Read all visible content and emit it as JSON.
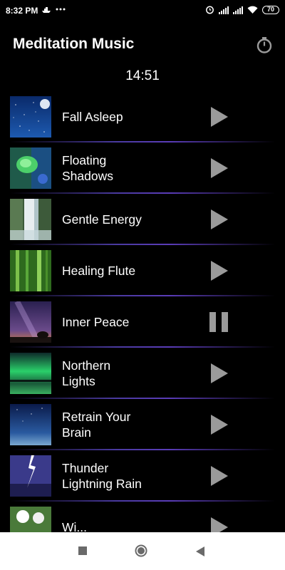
{
  "status_bar": {
    "time": "8:32 PM",
    "battery": "70",
    "icons": [
      "boat-icon",
      "more-dots-icon",
      "alarm-icon",
      "signal-icon",
      "signal-icon",
      "wifi-icon",
      "battery-icon"
    ]
  },
  "header": {
    "title": "Meditation Music",
    "timer_icon": "stopwatch-icon"
  },
  "timer": {
    "value": "14:51"
  },
  "tracks": [
    {
      "title": "Fall Asleep",
      "state": "play",
      "thumb": "starry-sky-moon"
    },
    {
      "title": "Floating\nShadows",
      "state": "play",
      "thumb": "green-leaf"
    },
    {
      "title": "Gentle Energy",
      "state": "play",
      "thumb": "waterfall"
    },
    {
      "title": "Healing Flute",
      "state": "play",
      "thumb": "bamboo-forest"
    },
    {
      "title": "Inner Peace",
      "state": "pause",
      "thumb": "milky-way-tree"
    },
    {
      "title": "Northern\nLights",
      "state": "play",
      "thumb": "aurora"
    },
    {
      "title": "Retrain Your\nBrain",
      "state": "play",
      "thumb": "night-sky-horizon"
    },
    {
      "title": "Thunder\nLightning Rain",
      "state": "play",
      "thumb": "lightning-storm"
    },
    {
      "title": "Wi...",
      "state": "play",
      "thumb": "white-flowers"
    }
  ],
  "colors": {
    "background": "#000000",
    "play_icon": "#9a9a9a",
    "divider": "#5a3cb8",
    "navbar": "#ffffff"
  },
  "navbar": {
    "icons": [
      "recents-square-icon",
      "home-circle-icon",
      "back-triangle-icon"
    ]
  }
}
